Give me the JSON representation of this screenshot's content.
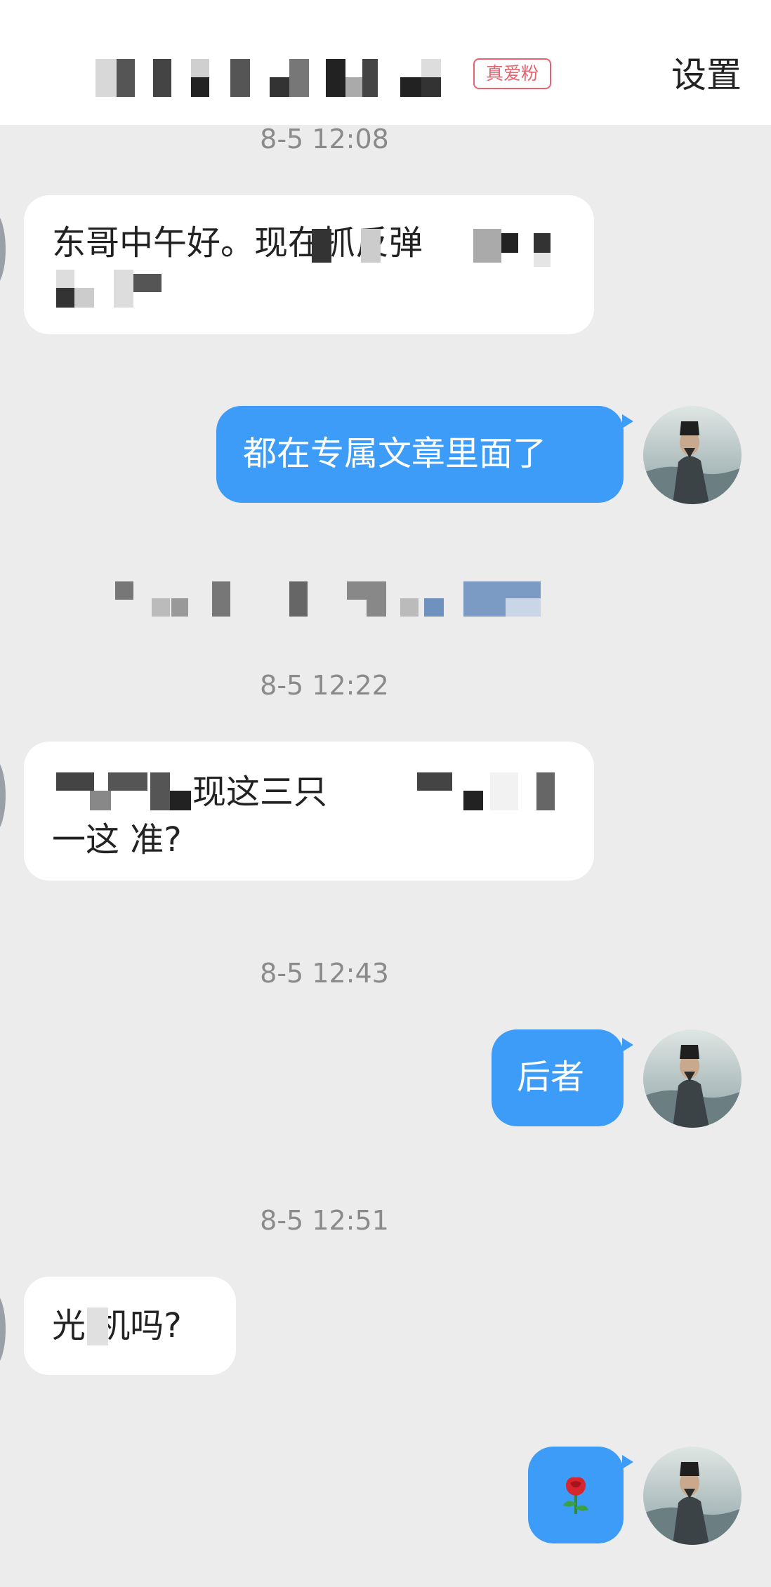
{
  "header": {
    "badge": "真爱粉",
    "settings": "设置"
  },
  "messages": [
    {
      "timestamp": "8-5 12:08"
    },
    {
      "sender": "them",
      "text": "东哥中午好。现在抓反弹"
    },
    {
      "sender": "me",
      "text": "都在专属文章里面了"
    },
    {
      "timestamp": "8-5 12:22"
    },
    {
      "sender": "them",
      "text": "现这三只"
    },
    {
      "sender": "them",
      "text": "一这 准?"
    },
    {
      "timestamp": "8-5 12:43"
    },
    {
      "sender": "me",
      "text": "后者"
    },
    {
      "timestamp": "8-5 12:51"
    },
    {
      "sender": "them",
      "text": "光 机吗?"
    },
    {
      "sender": "me",
      "sticker": "rose-icon"
    }
  ],
  "colors": {
    "outgoing_bubble": "#3d9cf8",
    "incoming_bubble": "#ffffff",
    "background": "#ececec",
    "badge": "#e8626f"
  }
}
